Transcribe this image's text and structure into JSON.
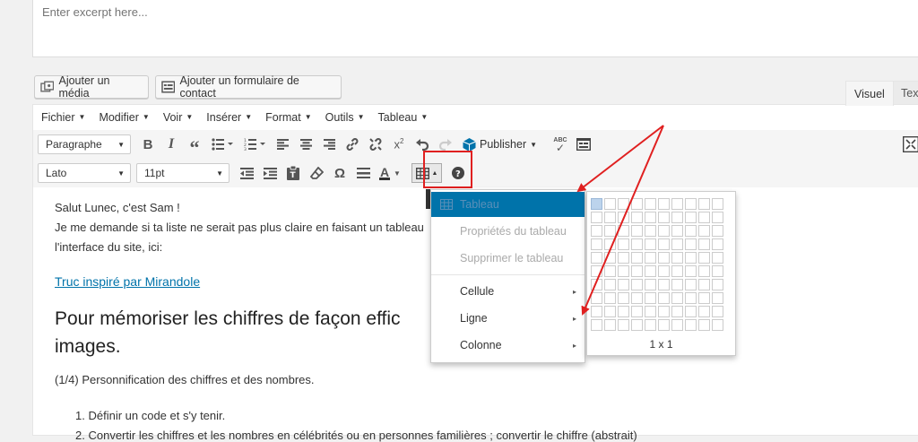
{
  "excerpt": {
    "placeholder": "Enter excerpt here..."
  },
  "media_buttons": {
    "add_media": "Ajouter un média",
    "add_contact_form": "Ajouter un formulaire de contact"
  },
  "editor_tabs": {
    "visual": "Visuel",
    "text": "Text"
  },
  "menubar": [
    {
      "label": "Fichier"
    },
    {
      "label": "Modifier"
    },
    {
      "label": "Voir"
    },
    {
      "label": "Insérer"
    },
    {
      "label": "Format"
    },
    {
      "label": "Outils"
    },
    {
      "label": "Tableau"
    }
  ],
  "toolbar1": {
    "paragraph_select": "Paragraphe",
    "publisher_label": "Publisher",
    "spellcheck_label": "ABC"
  },
  "toolbar2": {
    "font_select": "Lato",
    "size_select": "11pt",
    "omega": "Ω",
    "text_color_glyph": "A"
  },
  "content": {
    "greeting": "Salut Lunec, c'est Sam !",
    "line2": "Je me demande si ta liste ne serait pas plus claire en faisant un tableau",
    "line3": "l'interface du site, ici:",
    "link": "Truc inspiré par Mirandole",
    "heading_line1": "Pour mémoriser les chiffres de façon effic",
    "heading_line2": "images.",
    "subtitle": "(1/4) Personnification des chiffres et des nombres.",
    "list": [
      "Définir un code et s'y tenir.",
      "Convertir les chiffres et les nombres en célébrités ou en personnes familières ; convertir le chiffre (abstrait)"
    ]
  },
  "table_menu": {
    "items": [
      {
        "label": "Tableau",
        "state": "highlighted",
        "submenu": false
      },
      {
        "label": "Propriétés du tableau",
        "state": "disabled",
        "submenu": false
      },
      {
        "label": "Supprimer le tableau",
        "state": "disabled",
        "submenu": false
      },
      {
        "label": "Cellule",
        "state": "normal",
        "submenu": true
      },
      {
        "label": "Ligne",
        "state": "normal",
        "submenu": true
      },
      {
        "label": "Colonne",
        "state": "normal",
        "submenu": true
      }
    ]
  },
  "grid_picker": {
    "columns": 10,
    "rows": 10,
    "selected_cols": 1,
    "selected_rows": 1,
    "size_label": "1 x 1"
  },
  "colors": {
    "accent": "#0073aa",
    "annotation": "#e02020",
    "link": "#0073aa"
  }
}
